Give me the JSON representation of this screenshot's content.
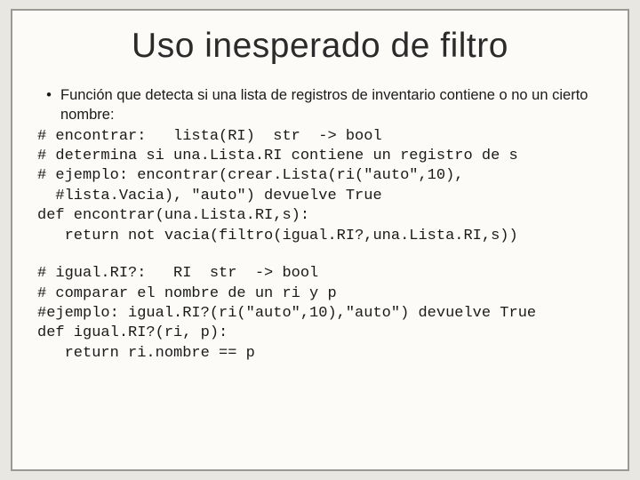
{
  "title": "Uso inesperado de filtro",
  "bullet": {
    "marker": "•",
    "text": "Función que detecta si una lista de registros de inventario contiene o no un cierto nombre:"
  },
  "code1": "# encontrar:   lista(RI)  str  -> bool\n# determina si una.Lista.RI contiene un registro de s\n# ejemplo: encontrar(crear.Lista(ri(\"auto\",10),\n  #lista.Vacia), \"auto\") devuelve True\ndef encontrar(una.Lista.RI,s):\n   return not vacia(filtro(igual.RI?,una.Lista.RI,s))",
  "code2": "# igual.RI?:   RI  str  -> bool\n# comparar el nombre de un ri y p\n#ejemplo: igual.RI?(ri(\"auto\",10),\"auto\") devuelve True\ndef igual.RI?(ri, p):\n   return ri.nombre == p"
}
